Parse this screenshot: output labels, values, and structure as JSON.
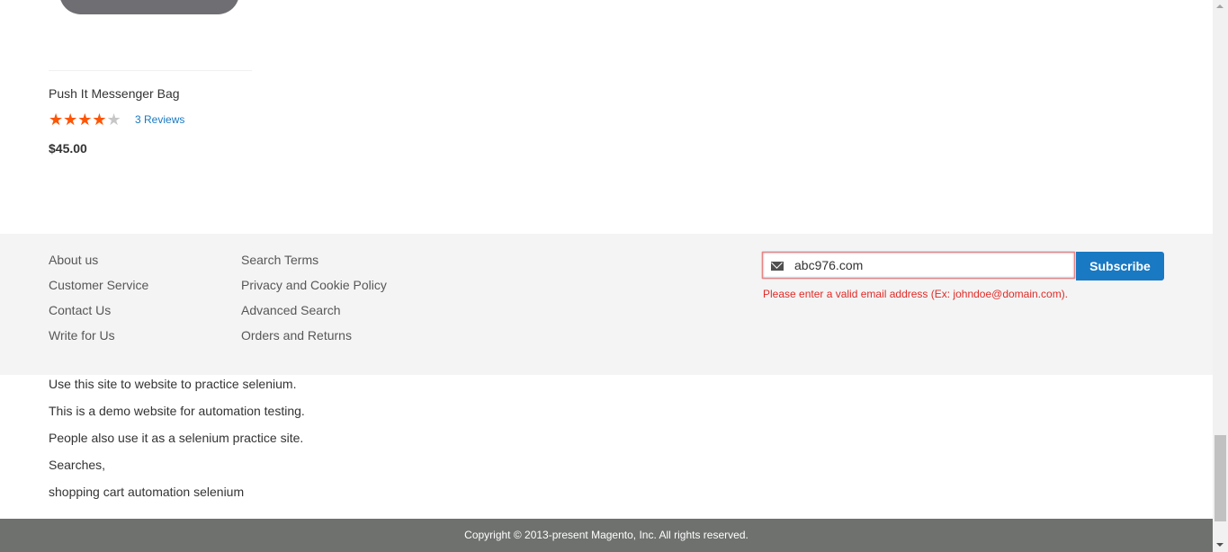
{
  "product": {
    "name": "Push It Messenger Bag",
    "rating_percent": 70,
    "reviews_label": "3 Reviews",
    "price": "$45.00"
  },
  "footer": {
    "links_col1": [
      "About us",
      "Customer Service",
      "Contact Us",
      "Write for Us"
    ],
    "links_col2": [
      "Search Terms",
      "Privacy and Cookie Policy",
      "Advanced Search",
      "Orders and Returns"
    ]
  },
  "newsletter": {
    "email_value": "abc976.com",
    "subscribe_label": "Subscribe",
    "error_message": "Please enter a valid email address (Ex: johndoe@domain.com)."
  },
  "info_lines": [
    "Use this site to website to practice selenium.",
    "This is a demo website for automation testing.",
    "People also use it as a selenium practice site.",
    "Searches,",
    "shopping cart automation selenium"
  ],
  "copyright": "Copyright © 2013-present Magento, Inc. All rights reserved.",
  "colors": {
    "accent": "#1979c3",
    "error": "#e02b27",
    "star": "#ff5501",
    "footer_bg": "#f4f4f4",
    "copyright_bg": "#6e716e"
  }
}
